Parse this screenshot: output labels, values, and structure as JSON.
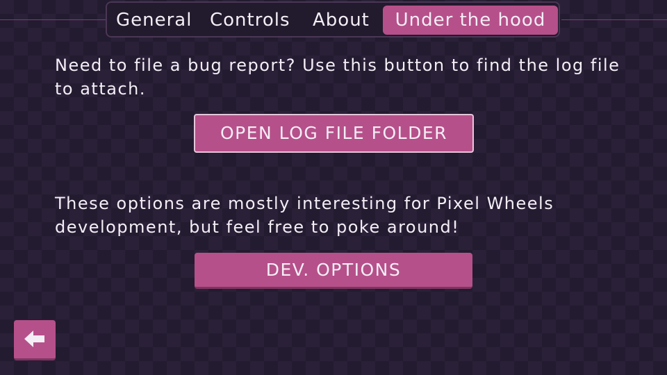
{
  "tabs": [
    {
      "label": "General",
      "selected": false
    },
    {
      "label": "Controls",
      "selected": false
    },
    {
      "label": "About",
      "selected": false
    },
    {
      "label": "Under the hood",
      "selected": true
    }
  ],
  "log_section": {
    "text": "Need to file a bug report? Use this button to find the log file to attach.",
    "button_label": "OPEN LOG FILE FOLDER"
  },
  "dev_section": {
    "text": "These options are mostly interesting for Pixel Wheels development, but feel free to poke around!",
    "button_label": "DEV. OPTIONS"
  },
  "back_button": {
    "icon": "arrow-left-icon"
  },
  "colors": {
    "accent": "#b6508a",
    "background": "#2a2138",
    "background_alt": "#231b2f",
    "text": "#f4eef6"
  }
}
